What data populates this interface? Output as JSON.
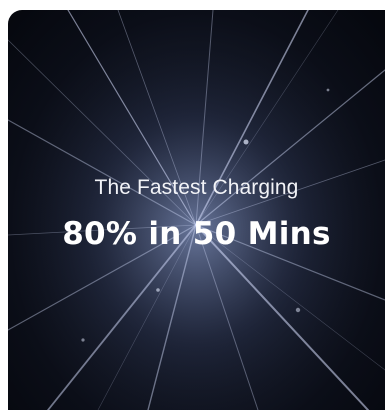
{
  "promo": {
    "headline": "The Fastest Charging",
    "subheadline": "80% in 50 Mins",
    "background": "light-speed-rays-image"
  },
  "colors": {
    "card_dark": "#0b0e18",
    "ray_glow": "#c8d4ff",
    "text": "#ffffff"
  }
}
